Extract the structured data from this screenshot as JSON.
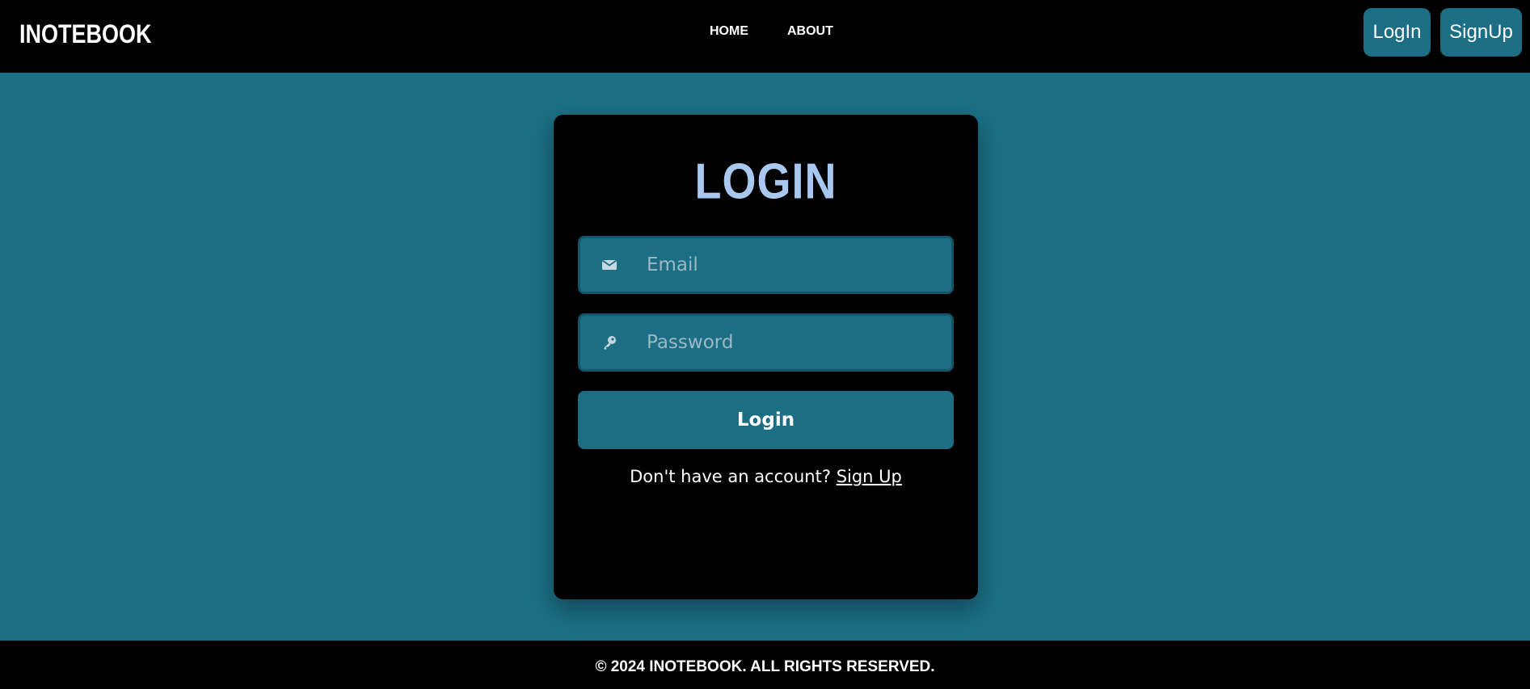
{
  "navbar": {
    "brand": "INOTEBOOK",
    "links": [
      "HOME",
      "ABOUT"
    ],
    "login_label": "LogIn",
    "signup_label": "SignUp"
  },
  "login_card": {
    "title": "LOGIN",
    "email_placeholder": "Email",
    "email_value": "",
    "email_icon": "envelope-icon",
    "password_placeholder": "Password",
    "password_value": "",
    "password_icon": "key-icon",
    "submit_label": "Login",
    "signup_prompt": "Don't have an account?",
    "signup_link": "Sign Up"
  },
  "footer": {
    "text": "© 2024 INOTEBOOK. ALL RIGHTS RESERVED."
  },
  "colors": {
    "background": "#1b6e84",
    "surface": "#000000",
    "title_accent": "#a8c8f0",
    "text": "#ffffff"
  }
}
